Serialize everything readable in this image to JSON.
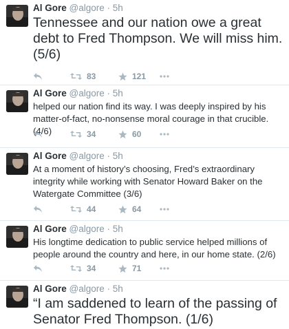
{
  "tweets": [
    {
      "name": "Al Gore",
      "handle": "@algore",
      "dot": "·",
      "time": "5h",
      "text": "Tennessee and our nation owe a great debt to Fred Thompson. We will miss him. (5/6)",
      "retweets": "83",
      "favorites": "121",
      "size": "big"
    },
    {
      "name": "Al Gore",
      "handle": "@algore",
      "dot": "·",
      "time": "5h",
      "text": "helped our nation find its way. I was deeply inspired by his matter-of-fact, no-nonsense moral courage in that crucible. (4/6)",
      "retweets": "34",
      "favorites": "60",
      "size": "small"
    },
    {
      "name": "Al Gore",
      "handle": "@algore",
      "dot": "·",
      "time": "5h",
      "text": "At a moment of history’s choosing, Fred’s extraordinary integrity while working with Senator Howard Baker on the Watergate Committee (3/6)",
      "retweets": "44",
      "favorites": "64",
      "size": "small"
    },
    {
      "name": "Al Gore",
      "handle": "@algore",
      "dot": "·",
      "time": "5h",
      "text": "His longtime dedication to public service helped millions of people around the country and here, in our home state. (2/6)",
      "retweets": "34",
      "favorites": "71",
      "size": "small"
    },
    {
      "name": "Al Gore",
      "handle": "@algore",
      "dot": "·",
      "time": "5h",
      "text": "“I am saddened to learn of the passing of Senator Fred Thompson. (1/6)",
      "size": "big"
    }
  ],
  "icons": {
    "reply": "reply-icon",
    "retweet": "retweet-icon",
    "favorite": "star-icon",
    "more": "more-dots-icon"
  },
  "colors": {
    "name": "#292f33",
    "meta": "#8899a6",
    "divider": "#e1e8ed"
  }
}
